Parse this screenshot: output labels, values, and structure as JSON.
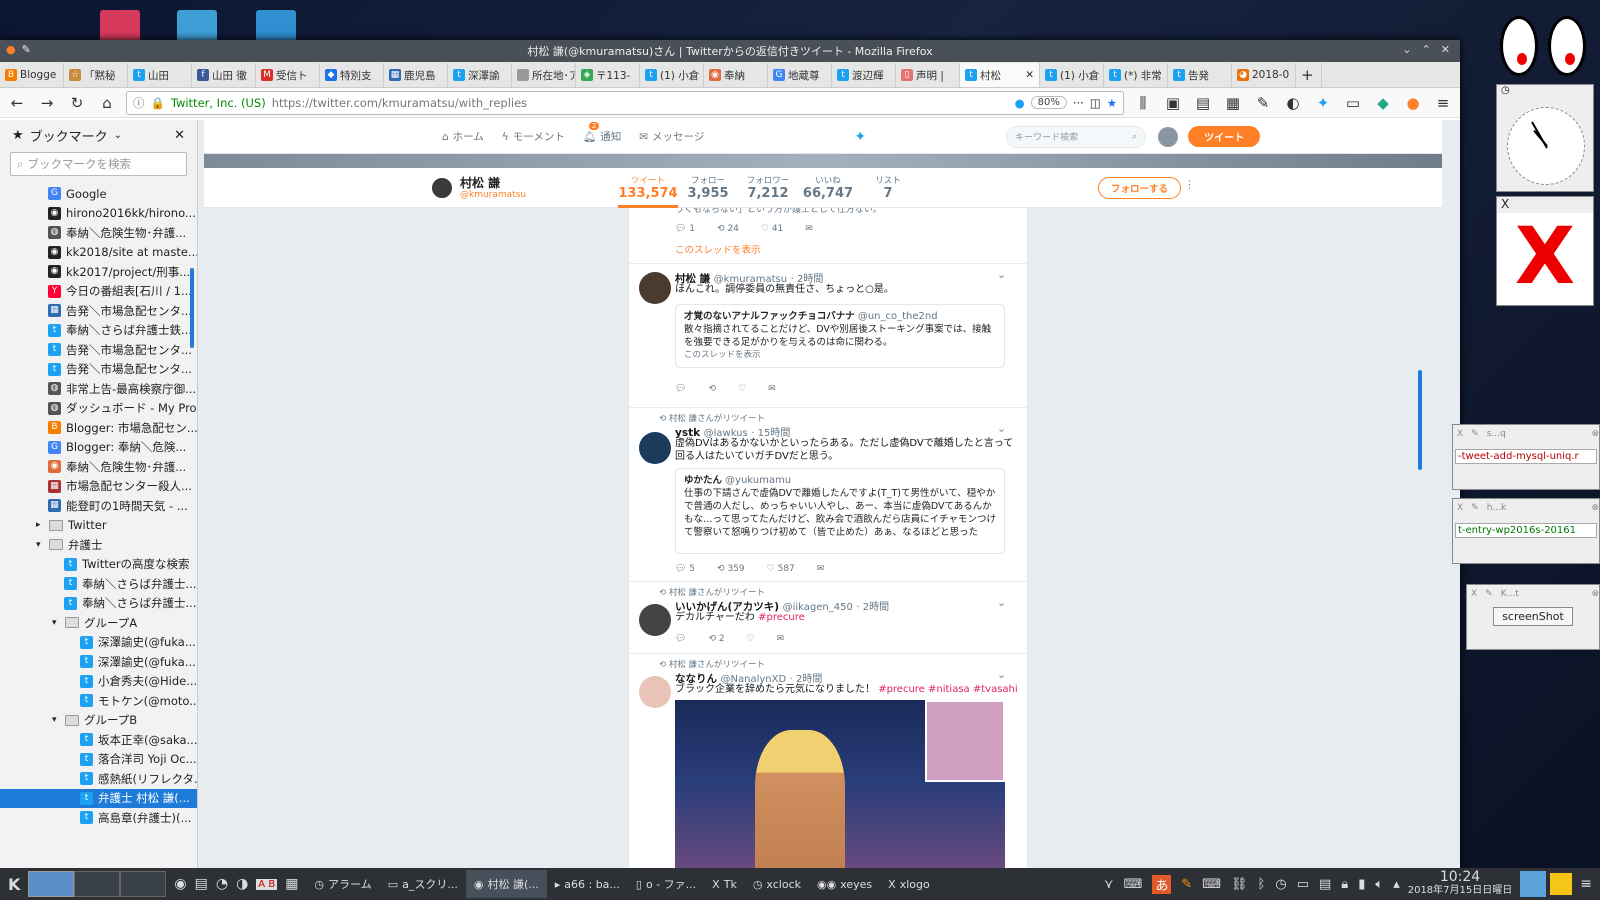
{
  "window": {
    "title": "村松 謙(@kmuramatsu)さん | Twitterからの返信付きツイート - Mozilla Firefox"
  },
  "tabs": [
    {
      "label": "Blogge",
      "color": "#f57d00",
      "icon": "B"
    },
    {
      "label": "「黙秘",
      "color": "#c78b3a",
      "icon": "☆"
    },
    {
      "label": "山田",
      "color": "#1da1f2",
      "icon": "t"
    },
    {
      "label": "山田 徹",
      "color": "#3b5998",
      "icon": "f"
    },
    {
      "label": "受信ト",
      "color": "#d93025",
      "icon": "M"
    },
    {
      "label": "特別支",
      "color": "#1a73e8",
      "icon": "◆"
    },
    {
      "label": "鹿児島",
      "color": "#2e6bb0",
      "icon": "▦"
    },
    {
      "label": "深澤諭",
      "color": "#1da1f2",
      "icon": "t"
    },
    {
      "label": "所在地･ア",
      "color": "#999",
      "icon": " "
    },
    {
      "label": "〒113-",
      "color": "#34a853",
      "icon": "◈"
    },
    {
      "label": "(1) 小倉",
      "color": "#1da1f2",
      "icon": "t"
    },
    {
      "label": "奉納",
      "color": "#e06c3c",
      "icon": "◉"
    },
    {
      "label": "地蔵尊",
      "color": "#4285f4",
      "icon": "G"
    },
    {
      "label": "渡辺輝",
      "color": "#1da1f2",
      "icon": "t"
    },
    {
      "label": "声明 |",
      "color": "#e57373",
      "icon": "▯"
    },
    {
      "label": "村松",
      "color": "#1da1f2",
      "icon": "t"
    },
    {
      "label": "(1) 小倉",
      "color": "#1da1f2",
      "icon": "t"
    },
    {
      "label": "(*) 非常",
      "color": "#1da1f2",
      "icon": "t"
    },
    {
      "label": "告発",
      "color": "#1da1f2",
      "icon": "t"
    },
    {
      "label": "2018-0",
      "color": "#e8710a",
      "icon": "◕"
    }
  ],
  "urlbar": {
    "org": "Twitter, Inc. (US)",
    "url": "https://twitter.com/kmuramatsu/with_replies",
    "zoom": "80%"
  },
  "sidebar": {
    "title": "ブックマーク",
    "search_placeholder": "ブックマークを検索",
    "items": [
      {
        "label": "Google",
        "indent": 0,
        "icon": "G",
        "color": "#4285f4"
      },
      {
        "label": "hirono2016kk/hirono...",
        "indent": 0,
        "icon": "◉",
        "color": "#222"
      },
      {
        "label": "奉納＼危険生物･弁護...",
        "indent": 0,
        "icon": "◍",
        "color": "#555"
      },
      {
        "label": "kk2018/site at maste...",
        "indent": 0,
        "icon": "◉",
        "color": "#222"
      },
      {
        "label": "kk2017/project/刑事...",
        "indent": 0,
        "icon": "◉",
        "color": "#222"
      },
      {
        "label": "今日の番組表[石川 / 1...",
        "indent": 0,
        "icon": "Y",
        "color": "#ff0033"
      },
      {
        "label": "告発＼市場急配センタ...",
        "indent": 0,
        "icon": "▦",
        "color": "#2e6bb0"
      },
      {
        "label": "奉納＼さらば弁護士鉄...",
        "indent": 0,
        "icon": "t",
        "color": "#1da1f2"
      },
      {
        "label": "告発＼市場急配センタ...",
        "indent": 0,
        "icon": "t",
        "color": "#1da1f2"
      },
      {
        "label": "告発＼市場急配センタ...",
        "indent": 0,
        "icon": "t",
        "color": "#1da1f2"
      },
      {
        "label": "非常上告-最高検察庁御...",
        "indent": 0,
        "icon": "◍",
        "color": "#555"
      },
      {
        "label": "ダッシュボード - My Pro...",
        "indent": 0,
        "icon": "◍",
        "color": "#555"
      },
      {
        "label": "Blogger: 市場急配セン...",
        "indent": 0,
        "icon": "B",
        "color": "#f57d00"
      },
      {
        "label": "Blogger: 奉納＼危険...",
        "indent": 0,
        "icon": "G",
        "color": "#4285f4"
      },
      {
        "label": "奉納＼危険生物･弁護...",
        "indent": 0,
        "icon": "◉",
        "color": "#e06c3c"
      },
      {
        "label": "市場急配センター殺人...",
        "indent": 0,
        "icon": "▦",
        "color": "#a33"
      },
      {
        "label": "能登町の1時間天気 - ...",
        "indent": 0,
        "icon": "▦",
        "color": "#2e6bb0"
      },
      {
        "label": "Twitter",
        "indent": 0,
        "icon": "▸",
        "color": "folder"
      },
      {
        "label": "弁護士",
        "indent": 0,
        "icon": "▾",
        "color": "folder"
      },
      {
        "label": "Twitterの高度な検索",
        "indent": 1,
        "icon": "t",
        "color": "#1da1f2"
      },
      {
        "label": "奉納＼さらば弁護士...",
        "indent": 1,
        "icon": "t",
        "color": "#1da1f2"
      },
      {
        "label": "奉納＼さらば弁護士...",
        "indent": 1,
        "icon": "t",
        "color": "#1da1f2"
      },
      {
        "label": "グループA",
        "indent": 1,
        "icon": "▾",
        "color": "folder"
      },
      {
        "label": "深澤諭史(@fuka...",
        "indent": 2,
        "icon": "t",
        "color": "#1da1f2"
      },
      {
        "label": "深澤諭史(@fuka...",
        "indent": 2,
        "icon": "t",
        "color": "#1da1f2"
      },
      {
        "label": "小倉秀夫(@Hide...",
        "indent": 2,
        "icon": "t",
        "color": "#1da1f2"
      },
      {
        "label": "モトケン(@moto...",
        "indent": 2,
        "icon": "t",
        "color": "#1da1f2"
      },
      {
        "label": "グループB",
        "indent": 1,
        "icon": "▾",
        "color": "folder"
      },
      {
        "label": "坂本正幸(@saka...",
        "indent": 2,
        "icon": "t",
        "color": "#1da1f2"
      },
      {
        "label": "落合洋司 Yoji Oc...",
        "indent": 2,
        "icon": "t",
        "color": "#1da1f2"
      },
      {
        "label": "感熱紙(リフレクタ...",
        "indent": 2,
        "icon": "t",
        "color": "#1da1f2"
      },
      {
        "label": "弁護士 村松 謙(...",
        "indent": 2,
        "icon": "t",
        "color": "#1da1f2",
        "selected": true
      },
      {
        "label": "高島章(弁護士)(...",
        "indent": 2,
        "icon": "t",
        "color": "#1da1f2"
      }
    ]
  },
  "twitter_nav": {
    "home": "ホーム",
    "moments": "モーメント",
    "notifications": "通知",
    "messages": "メッセージ",
    "search_placeholder": "キーワード検索",
    "tweet_button": "ツイート",
    "notif_count": "2"
  },
  "profile": {
    "name": "村松 謙",
    "handle": "@kmuramatsu",
    "stats": [
      {
        "label": "ツイート",
        "value": "133,574"
      },
      {
        "label": "フォロー",
        "value": "3,955"
      },
      {
        "label": "フォロワー",
        "value": "7,212"
      },
      {
        "label": "いいね",
        "value": "66,747"
      },
      {
        "label": "リスト",
        "value": "7"
      }
    ],
    "follow_button": "フォローする"
  },
  "tweets": {
    "t0": {
      "partial_text": "うくもならない」という方が護士として仕方ない。",
      "reply": "1",
      "retweet": "24",
      "like": "41",
      "thread": "このスレッドを表示"
    },
    "t1": {
      "name": "村松 謙",
      "handle": "@kmuramatsu",
      "time": "· 2時間",
      "text": "ほんこれ。調停委員の無責任さ、ちょっと○是。",
      "quote_name": "才覚のないアナルファックチョコバナナ",
      "quote_handle": "@un_co_the2nd",
      "quote_text": "散々指摘されてることだけど、DVや別居後ストーキング事案では、接触を強要できる足がかりを与えるのは命に関わる。",
      "quote_thread": "このスレッドを表示"
    },
    "t2": {
      "rt_label": "村松 謙さんがリツイート",
      "name": "ystk",
      "handle": "@lawkus",
      "time": "· 15時間",
      "text": "虚偽DVはあるかないかといったらある。ただし虚偽DVで離婚したと言って回る人はたいていガチDVだと思う。",
      "quote_name": "ゆかたん",
      "quote_handle": "@yukumamu",
      "quote_text": "仕事の下請さんで虚偽DVで離婚したんですよ(T_T)て男性がいて、穏やかで普通の人だし、めっちゃいい人やし、あー、本当に虚偽DVてあるんかもな…って思ってたんだけど、飲み会で酒飲んだら店員にイチャモンつけて警察いて怒鳴りつけ初めて（皆で止めた）あぁ、なるほどと思った",
      "reply": "5",
      "retweet": "359",
      "like": "587"
    },
    "t3": {
      "rt_label": "村松 謙さんがリツイート",
      "name": "いいかげん(アカツキ)",
      "handle": "@iikagen_450",
      "time": "· 2時間",
      "text": "デカルチャーだわ ",
      "hashtag": "#precure",
      "retweet": "2"
    },
    "t4": {
      "rt_label": "村松 謙さんがリツイート",
      "name": "ななりん",
      "handle": "@NanalynXD",
      "time": "· 2時間",
      "text": "ブラック企業を辞めたら元気になりました！ ",
      "hashtags": "#precure #nitiasa #tvasahi"
    }
  },
  "right_panel": {
    "win1_text": "-tweet-add-mysql-uniq.r",
    "win2_text": "t-entry-wp2016s-20161",
    "win3_button": "screenShot",
    "win1_title": "s...q",
    "win2_title": "h...k",
    "win3_title": "K...t"
  },
  "taskbar": {
    "items": [
      "アラーム",
      "a_スクリ...",
      "村松 謙(...",
      "a66 : ba...",
      "o - ファ...",
      "Tk",
      "xclock",
      "xeyes",
      "xlogo"
    ],
    "time": "10:24",
    "date": "2018年7月15日日曜日",
    "ime": "あ",
    "kbd": "A B"
  },
  "colors": {
    "twitter_blue": "#1da1f2",
    "accent_orange": "#ff7f27",
    "link_red": "#e0245e"
  }
}
